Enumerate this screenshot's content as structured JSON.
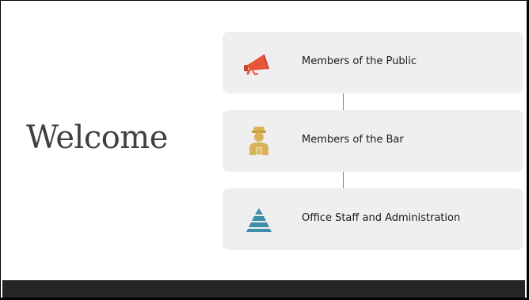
{
  "slide": {
    "title": "Welcome",
    "items": [
      {
        "label": "Members of the Public",
        "icon": "megaphone-icon",
        "icon_color": "#e8553a"
      },
      {
        "label": "Members of the Bar",
        "icon": "judge-icon",
        "icon_color": "#d9b25a"
      },
      {
        "label": "Office Staff and Administration",
        "icon": "pyramid-icon",
        "icon_color": "#3f8fa8"
      }
    ]
  },
  "colors": {
    "background": "#ffffff",
    "card": "#efefef",
    "footer": "#262626",
    "title": "#404040",
    "connector": "#7f7f7f"
  }
}
